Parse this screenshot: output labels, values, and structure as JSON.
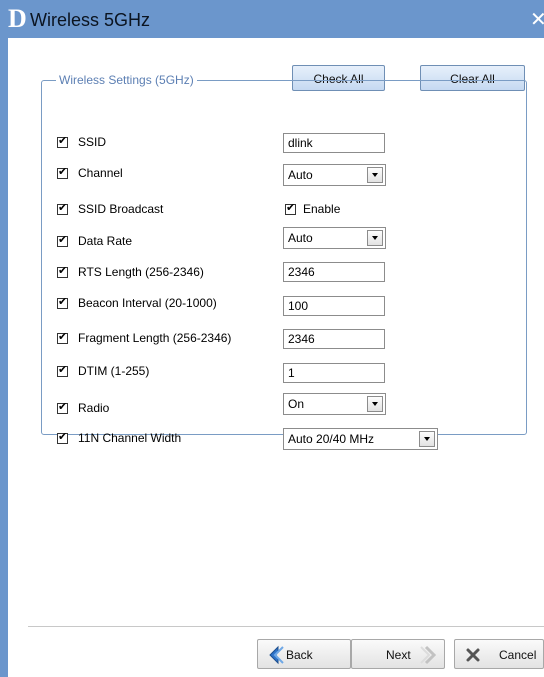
{
  "window": {
    "title": "Wireless 5GHz",
    "logo": "D",
    "close": "✕"
  },
  "buttons": {
    "check_all": "Check All",
    "clear_all": "Clear All"
  },
  "group_title": "Wireless Settings (5GHz)",
  "settings": [
    {
      "label": "SSID",
      "checked": true,
      "control": "input",
      "value": "dlink"
    },
    {
      "label": "Channel",
      "checked": true,
      "control": "select",
      "value": "Auto"
    },
    {
      "label": "SSID Broadcast",
      "checked": true,
      "control": "checkbox",
      "value": "Enable"
    },
    {
      "label": "Data Rate",
      "checked": true,
      "control": "select",
      "value": "Auto"
    },
    {
      "label": "RTS Length (256-2346)",
      "checked": true,
      "control": "input",
      "value": "2346"
    },
    {
      "label": "Beacon Interval (20-1000)",
      "checked": true,
      "control": "input",
      "value": "100"
    },
    {
      "label": "Fragment Length (256-2346)",
      "checked": true,
      "control": "input",
      "value": "2346"
    },
    {
      "label": "DTIM (1-255)",
      "checked": true,
      "control": "input",
      "value": "1"
    },
    {
      "label": "Radio",
      "checked": true,
      "control": "select",
      "value": "On"
    },
    {
      "label": "11N Channel Width",
      "checked": true,
      "control": "select",
      "value": "Auto 20/40 MHz"
    }
  ],
  "nav": {
    "back": "Back",
    "next": "Next",
    "cancel": "Cancel"
  },
  "colors": {
    "titlebar": "#6b96cc",
    "group_border": "#7a9cc4",
    "legend": "#5c7fb3"
  }
}
